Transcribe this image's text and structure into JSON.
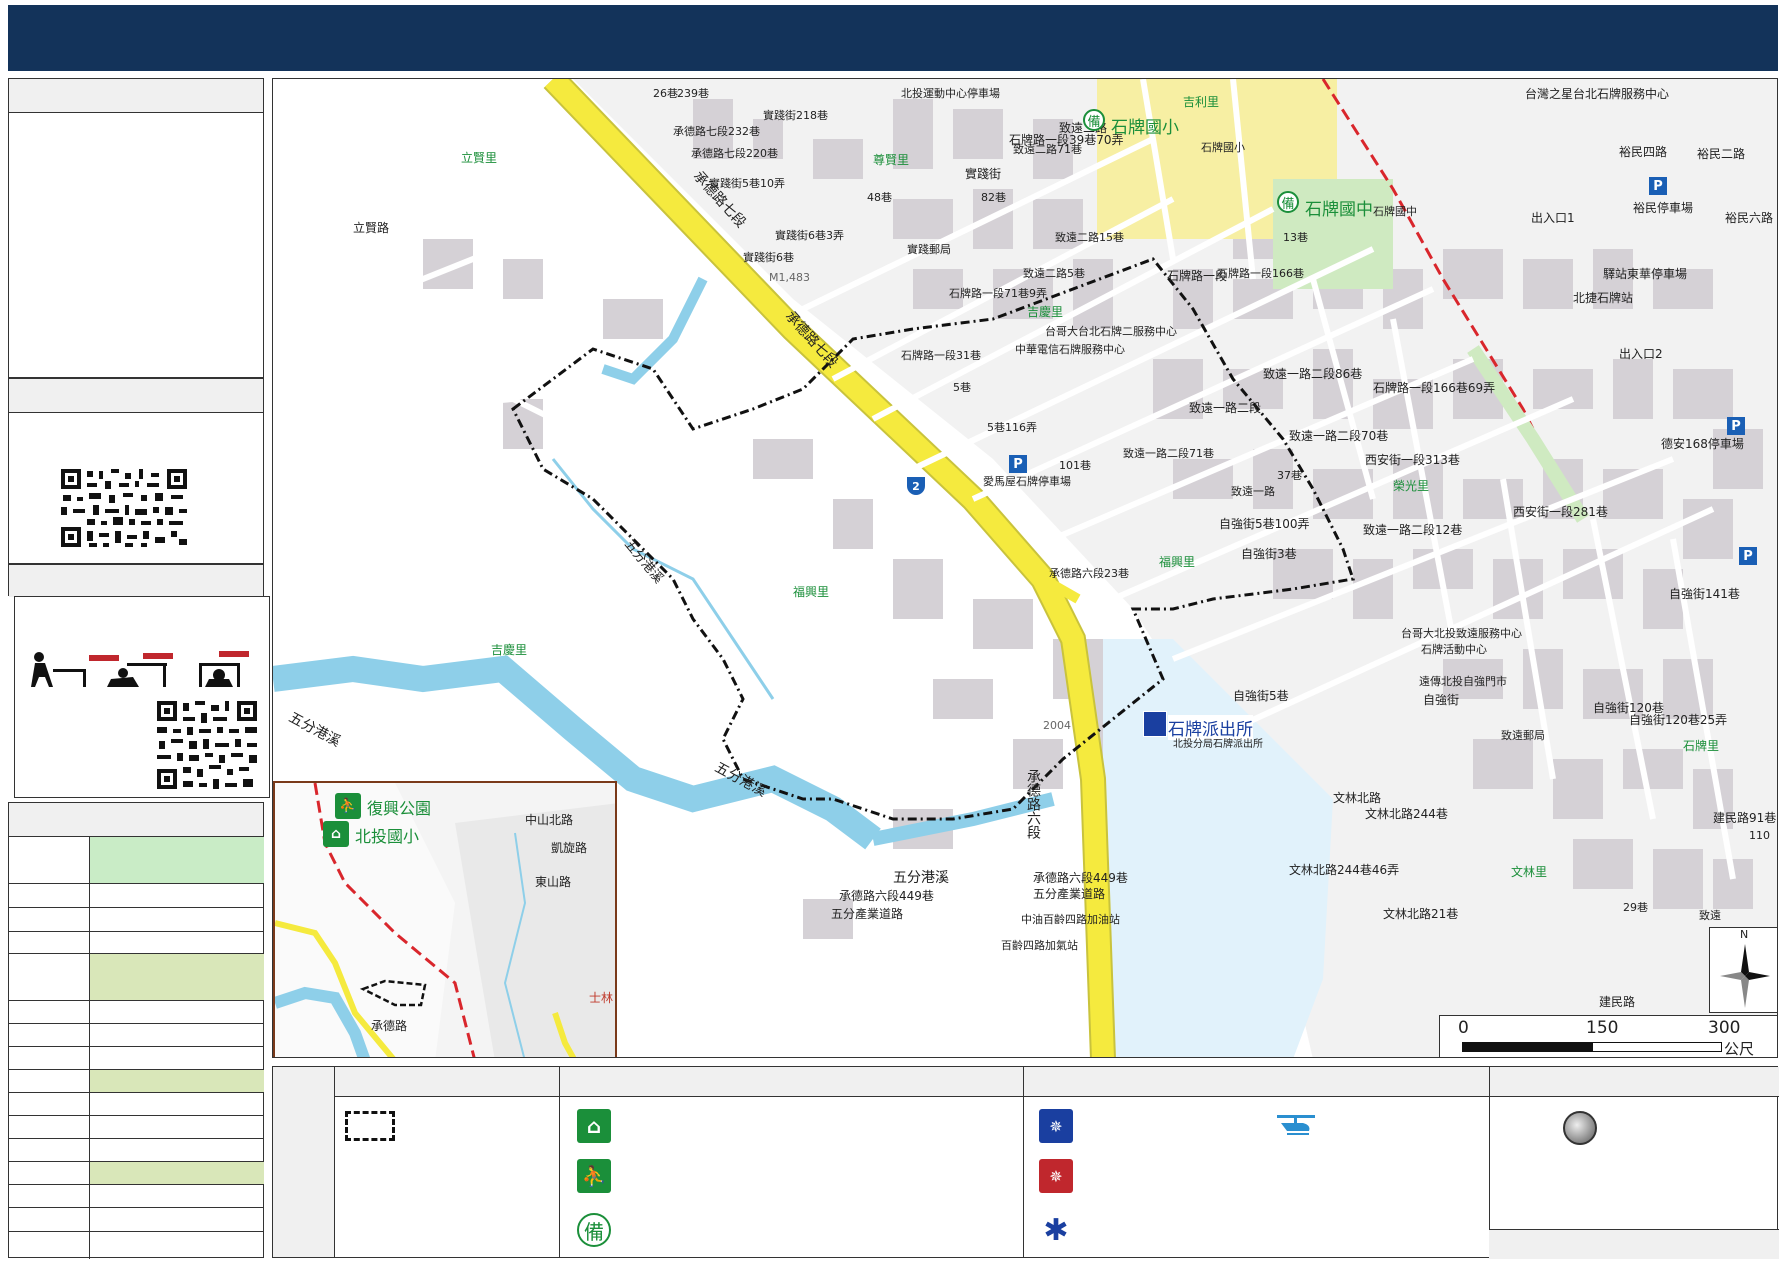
{
  "map": {
    "labels": {
      "shipai_elem": "石牌國小",
      "shipai_junior": "石牌國中",
      "shipai_police": "石牌派出所",
      "fuxing_park": "復興公園",
      "beitou_elem": "北投國小",
      "wufen_creek_1": "五分港溪",
      "wufen_creek_2": "五分港溪",
      "wufen_creek_3": "五分港溪",
      "wufen_creek_4": "五分港溪",
      "chengde_7": "承德路七段",
      "chengde_7b": "承德路七段",
      "chengde_6": "承德路六段",
      "chengde_road_inset": "承德路",
      "zhongshan_n": "中山北路",
      "kaixuan": "凱旋路",
      "dongshan": "東山路",
      "shilin": "士林",
      "fuxing_li": "福興里",
      "jiqing_li": "吉慶里",
      "jiqing_li2": "吉慶里",
      "lixian_li": "立賢里",
      "zunxian_li": "尊賢里",
      "jili_li": "吉利里",
      "rongguang_li": "榮光里",
      "shipai_li": "石牌里",
      "wenlin_li": "文林里",
      "fuxing_li2": "福興里",
      "shipai_rd_1": "石牌路一段",
      "shipai_rd_39": "石牌路一段39巷70弄",
      "shijian_st": "實踐街",
      "zhiyuan_2": "致遠二路",
      "zhiyuan_1": "致遠一路二段",
      "zhiyuan_1_70": "致遠一路二段70巷",
      "zhiyuan_1_86": "致遠一路二段86巷",
      "zhiyuan_1_12": "致遠一路二段12巷",
      "xian_st": "西安街一段313巷",
      "xian_st_281": "西安街一段281巷",
      "shipai_166": "石牌路一段166巷69弄",
      "wenlin_n": "文林北路",
      "wenlin_n_244": "文林北路244巷",
      "wenlin_n_46": "文林北路244巷46弄",
      "wenlin_n_21": "文林北路21巷",
      "jianmin": "建民路",
      "jianmin_91": "建民路91巷",
      "ziqiang_st": "自強街",
      "ziqiang_120": "自強街120巷",
      "ziqiang_120_25": "自強街120巷25弄",
      "ziqiang_141": "自強街141巷",
      "ziqiang_5": "自強街5巷",
      "ziqiang_100": "自強街5巷100弄",
      "ziqiang_3": "自強街3巷",
      "yumin": "裕民四路",
      "yumin_2": "裕民二路",
      "yumin_6": "裕民六路",
      "lixian_rd": "立賢路",
      "wufen_industry": "五分產業道路",
      "chengde_449": "承德路六段449巷",
      "chengde_449b": "承德路六段449巷",
      "wufen_industry2": "五分產業道路",
      "shipai_park_n": "台灣之星台北石牌服務中心",
      "yumin_parking": "裕民停車場",
      "station_east_parking": "驛站東華停車場",
      "mrt_shipai": "北捷石牌站",
      "exit1": "出入口1",
      "exit2": "出入口2",
      "xian168_parking": "德安168停車場",
      "shipai_junior_sm": "石牌國中",
      "shipai_elem_sm": "石牌國小",
      "beitou_sports_parking": "北投運動中心停車場",
      "shipai_post": "實踐郵局",
      "zhiyuan_post": "致遠郵局",
      "chunghwa": "中華電信石牌服務中心",
      "taiwan_mobile": "台哥大台北石牌二服務中心",
      "taiwan_mobile2": "台哥大北投致遠服務中心",
      "shipai_activity": "石牌活動中心",
      "ziqiang_market": "遠傳北投自強門市",
      "shipai_parking": "愛馬屋石牌停車場",
      "cpc_station": "中油百齡四路加油站",
      "bailing_station": "百齡四路加氣站",
      "shipai_police_sm": "北投分局石牌派出所",
      "m1483": "M1,483",
      "r2004": "2004",
      "chengde_232": "承德路七段232巷",
      "chengde_220": "承德路七段220巷",
      "shijian_5_10": "實踐街5巷10弄",
      "shijian_218": "實踐街218巷",
      "shijian_6_3": "實踐街6巷3弄",
      "shijian_6": "實踐街6巷",
      "shipai_71_9": "石牌路一段71巷9弄",
      "zhiyuan_15": "致遠二路15巷",
      "zhiyuan_5": "致遠二路5巷",
      "zhiyuan_71": "致遠二路71巷",
      "zhiyuan_1_71": "致遠一路二段71巷",
      "zhiyuan_rd": "致遠一路",
      "shipai_1_166": "石牌路一段166巷",
      "st_239": "239巷",
      "st_26": "26巷",
      "st_48": "48巷",
      "st_82": "82巷",
      "st_101": "101巷",
      "st_116": "5巷116弄",
      "st_1_31": "石牌路一段31巷",
      "st_5": "5巷",
      "st_37": "37巷",
      "st_13": "13巷",
      "st_110": "110",
      "st_29": "29巷",
      "chengde_6_23": "承德路六段23巷",
      "zhiyuan_st": "致遠"
    },
    "scale": {
      "tick0": "0",
      "tick1": "150",
      "tick2": "300",
      "unit": "公尺"
    },
    "north": "N"
  },
  "legend": {
    "shelter_symbol": "備"
  }
}
